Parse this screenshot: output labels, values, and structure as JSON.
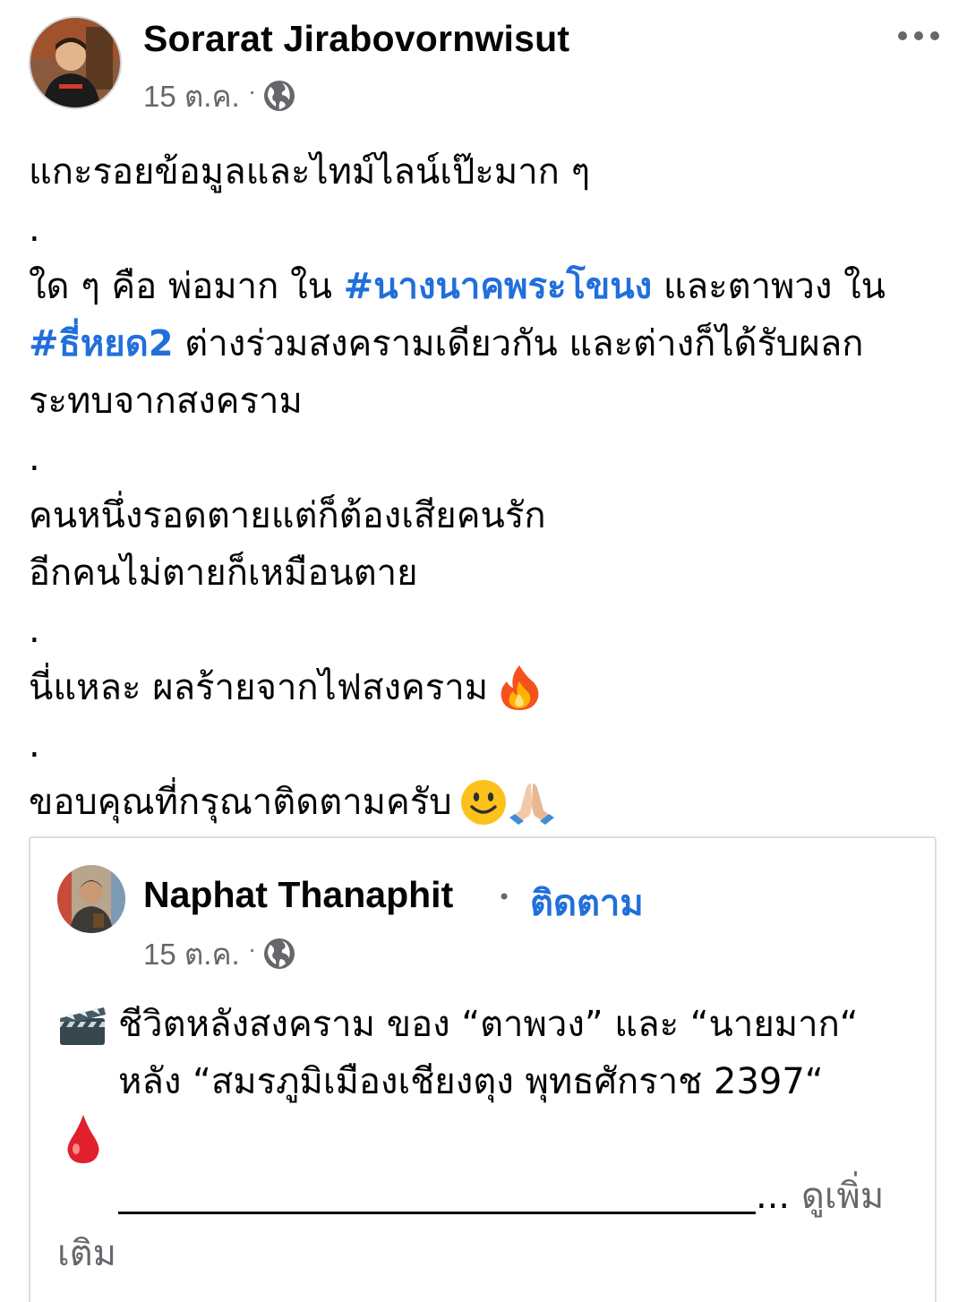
{
  "post": {
    "author": "Sorarat Jirabovornwisut",
    "date": "15 ต.ค.",
    "separator": "·",
    "lines": {
      "l1": "แกะรอยข้อมูลและไทม์ไลน์เป๊ะมาก ๆ",
      "d1": ".",
      "l2a": "ใด ๆ คือ พ่อมาก ใน ",
      "l2tag": "#นางนาคพระโขนง",
      "l2b": " และตาพวง ใน",
      "l3tag": "#ธี่หยด2",
      "l3b": " ต่างร่วมสงครามเดียวกัน และต่างก็ได้รับผลก",
      "l4": "ระทบจากสงคราม",
      "d2": ".",
      "l5": "คนหนึ่งรอดตายแต่ก็ต้องเสียคนรัก",
      "l6": "อีกคนไม่ตายก็เหมือนตาย",
      "d3": ".",
      "l7": "นี่แหละ ผลร้ายจากไฟสงคราม",
      "d4": ".",
      "l8": "ขอบคุณที่กรุณาติดตามครับ"
    }
  },
  "shared": {
    "author": "Naphat Thanaphit",
    "dot": "•",
    "follow_label": "ติดตาม",
    "date": "15 ต.ค.",
    "separator": "·",
    "line1": "ชีวิตหลังสงคราม ของ “ตาพวง” และ “นายมาก“",
    "line2": "หลัง “สมรภูมิเมืองเชียงตุง พุทธศักราช 2397“",
    "ellipsis": "... ",
    "see_more_a": "ดูเพิ่ม",
    "see_more_b": "เติม"
  },
  "colors": {
    "link": "#216fdb",
    "meta": "#65676b",
    "text": "#050505",
    "border": "#dadde1"
  },
  "icons": [
    "globe-icon",
    "more-options-icon",
    "fire-emoji-icon",
    "smile-emoji-icon",
    "pray-emoji-icon",
    "clapperboard-emoji-icon",
    "blood-drop-emoji-icon"
  ]
}
